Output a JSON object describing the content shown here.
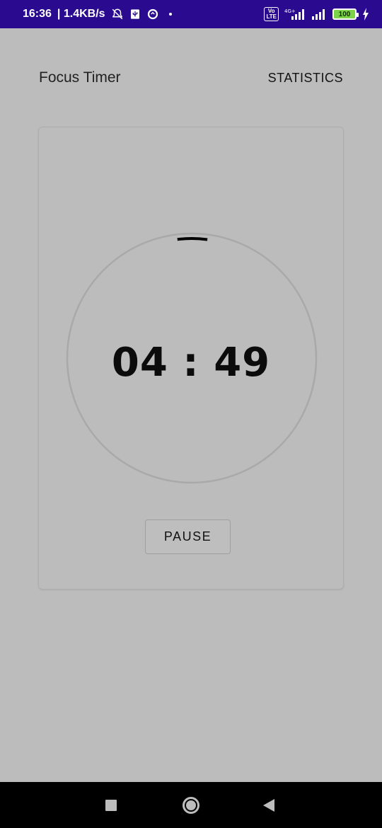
{
  "status_bar": {
    "time": "16:36",
    "net_speed": "| 1.4KB/s",
    "network_type": "4G+",
    "volte": "Vo LTE",
    "battery": "100",
    "icons": [
      "notifications-off-icon",
      "usb-icon",
      "data-saver-icon",
      "dot-icon",
      "signal-icon",
      "signal-icon",
      "battery-icon",
      "charging-icon"
    ]
  },
  "header": {
    "title": "Focus Timer",
    "stats_label": "STATISTICS"
  },
  "timer": {
    "time_display": "04 : 49",
    "pause_label": "PAUSE",
    "progress_fraction": 0.04
  },
  "nav": {
    "icons": [
      "recent-apps-icon",
      "home-icon",
      "back-icon"
    ]
  },
  "colors": {
    "status_bar": "#2a0a8f",
    "background": "#bcbcbc",
    "ring": "#a9a9a9",
    "progress": "#000000",
    "battery": "#7cd34a"
  }
}
